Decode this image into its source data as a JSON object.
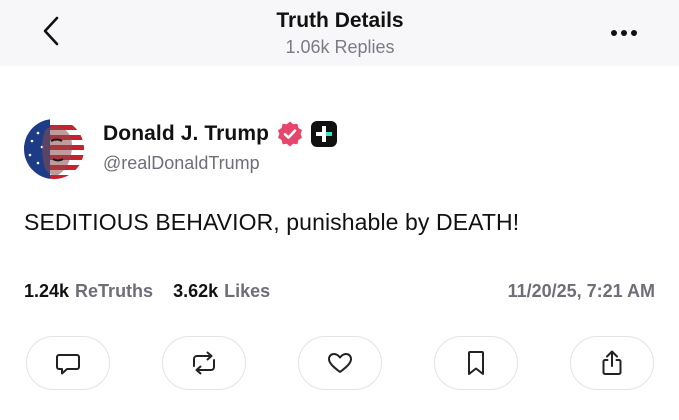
{
  "header": {
    "title": "Truth Details",
    "subtitle": "1.06k Replies",
    "back_icon": "chevron-left-icon",
    "more_icon": "more-horizontal-icon"
  },
  "post": {
    "author_name": "Donald J. Trump",
    "handle": "@realDonaldTrump",
    "verified_icon": "verified-badge-icon",
    "verified_color": "#e8456b",
    "plus_icon": "truth-plus-badge-icon",
    "text": "SEDITIOUS BEHAVIOR, punishable by DEATH!",
    "retruths_count": "1.24k",
    "retruths_label": "ReTruths",
    "likes_count": "3.62k",
    "likes_label": "Likes",
    "timestamp": "11/20/25, 7:21 AM"
  },
  "actions": [
    {
      "icon": "reply-icon"
    },
    {
      "icon": "retruth-icon"
    },
    {
      "icon": "like-icon"
    },
    {
      "icon": "bookmark-icon"
    },
    {
      "icon": "share-icon"
    }
  ]
}
